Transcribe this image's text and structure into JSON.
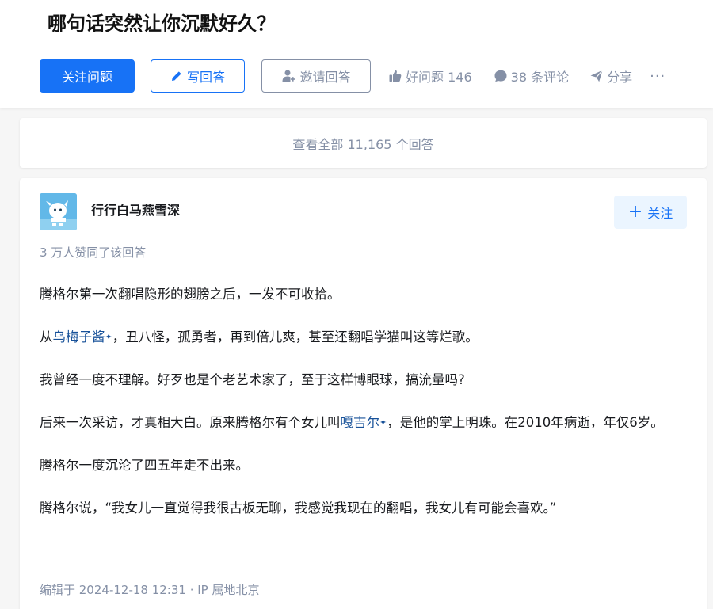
{
  "question": {
    "title": "哪句话突然让你沉默好久？"
  },
  "actions": {
    "follow_label": "关注问题",
    "write_label": "写回答",
    "invite_label": "邀请回答",
    "good_question_label": "好问题 146",
    "comments_label": "38 条评论",
    "share_label": "分享",
    "more_label": "···"
  },
  "view_all": {
    "label": "查看全部 11,165 个回答"
  },
  "answer": {
    "author_name": "行行白马燕雪深",
    "follow_label": "关注",
    "voters_text": "3 万人赞同了该回答",
    "paragraphs": {
      "p1": "腾格尔第一次翻唱隐形的翅膀之后，一发不可收拾。",
      "p2_pre": "从",
      "p2_link": "乌梅子酱",
      "p2_post": "，丑八怪，孤勇者，再到倍儿爽，甚至还翻唱学猫叫这等烂歌。",
      "p3": "我曾经一度不理解。好歹也是个老艺术家了，至于这样博眼球，搞流量吗?",
      "p4_pre": "后来一次采访，才真相大白。原来腾格尔有个女儿叫",
      "p4_link": "嘎吉尔",
      "p4_post": "，是他的掌上明珠。在2010年病逝，年仅6岁。",
      "p5": "腾格尔一度沉沦了四五年走不出来。",
      "p6": "腾格尔说，“我女儿一直觉得我很古板无聊，我感觉我现在的翻唱，我女儿有可能会喜欢。”"
    },
    "link_sparkle": "✦",
    "edited_text": "编辑于 2024-12-18 12:31 · IP 属地北京"
  },
  "colors": {
    "brand_blue": "#1772f6",
    "link_blue": "#175199",
    "muted_gray": "#8590a6",
    "page_bg": "#f6f6f6"
  },
  "icons": [
    "pencil-icon",
    "person-add-icon",
    "thumbs-up-icon",
    "comment-bubble-icon",
    "paper-plane-icon",
    "plus-icon"
  ]
}
